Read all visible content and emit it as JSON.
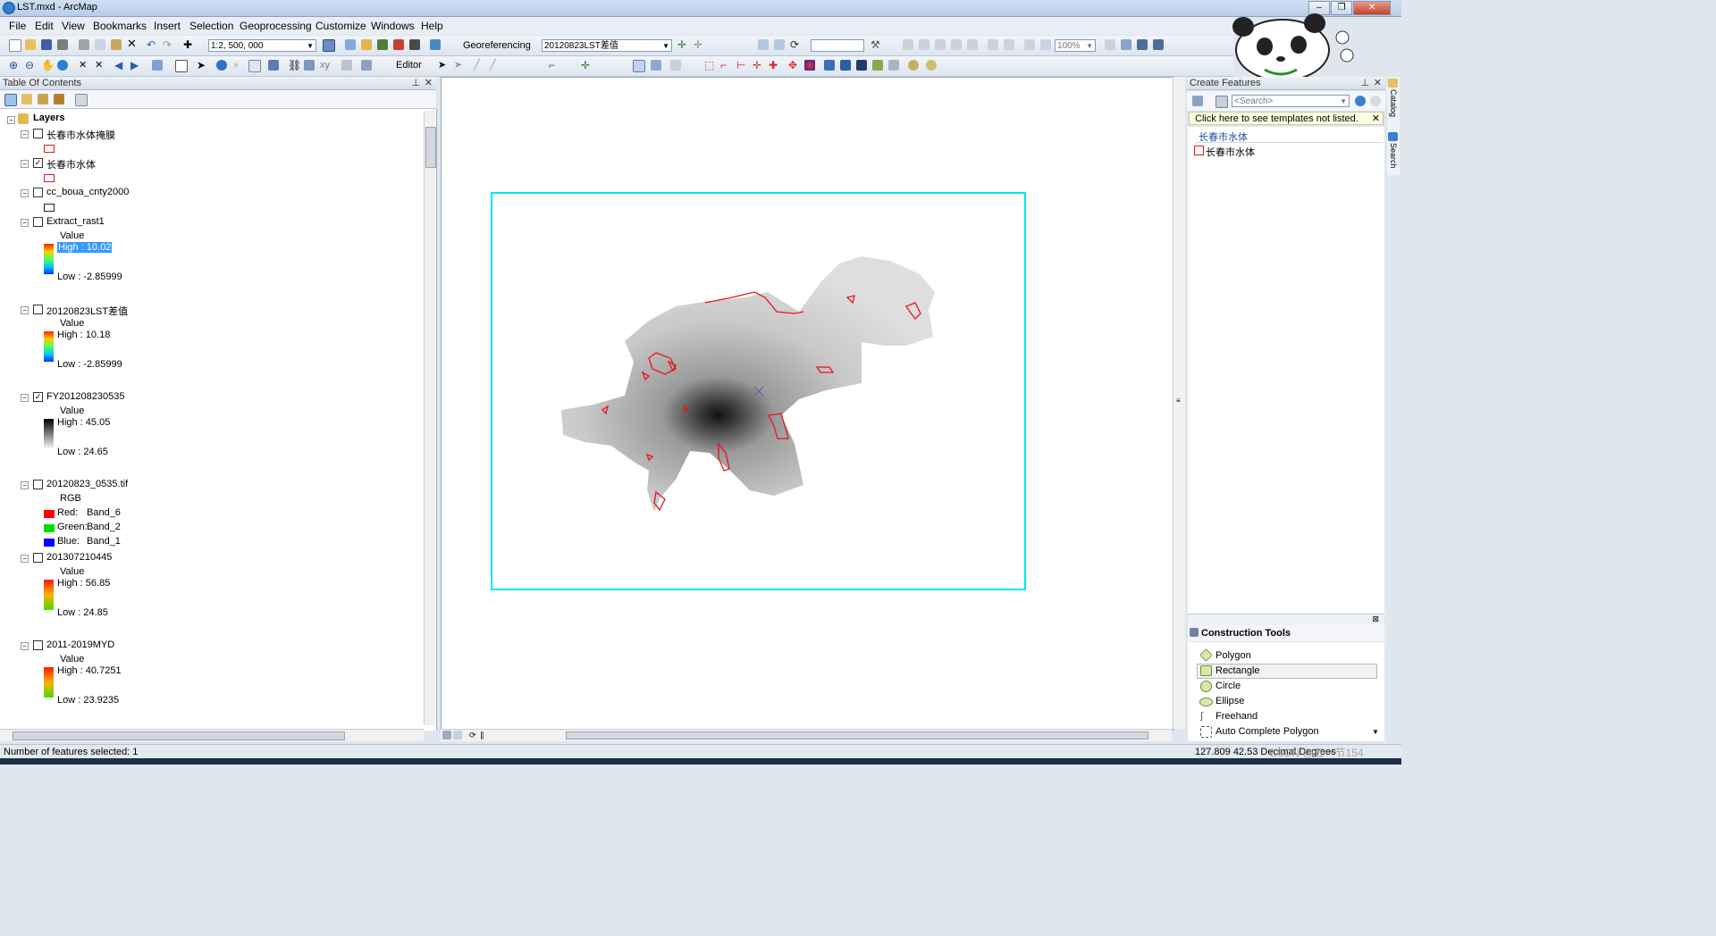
{
  "window": {
    "title": "LST.mxd - ArcMap"
  },
  "menu": [
    "File",
    "Edit",
    "View",
    "Bookmarks",
    "Insert",
    "Selection",
    "Geoprocessing",
    "Customize",
    "Windows",
    "Help"
  ],
  "toolbar": {
    "scale_value": "1:2, 500, 000",
    "georeferencing_label": "Georeferencing",
    "georef_layer": "20120823LST差值",
    "zoom_percent": "100%",
    "editor_label": "Editor"
  },
  "toc": {
    "title": "Table Of Contents",
    "root": "Layers",
    "layers": [
      {
        "name": "长春市水体掩膜",
        "checked": false
      },
      {
        "name": "长春市水体",
        "checked": true
      },
      {
        "name": "cc_boua_cnty2000",
        "checked": false
      },
      {
        "name": "Extract_rast1",
        "checked": false,
        "value_label": "Value",
        "high": "High : 10.02",
        "low": "Low : -2.85999"
      },
      {
        "name": "20120823LST差值",
        "checked": false,
        "value_label": "Value",
        "high": "High : 10.18",
        "low": "Low : -2.85999"
      },
      {
        "name": "FY201208230535",
        "checked": true,
        "value_label": "Value",
        "high": "High : 45.05",
        "low": "Low : 24.65"
      },
      {
        "name": "20120823_0535.tif",
        "checked": false,
        "rgb_label": "RGB",
        "red": "Red:",
        "red_band": "Band_6",
        "green": "Green:",
        "green_band": "Band_2",
        "blue": "Blue:",
        "blue_band": "Band_1"
      },
      {
        "name": "201307210445",
        "checked": false,
        "value_label": "Value",
        "high": "High : 56.85",
        "low": "Low : 24.85"
      },
      {
        "name": "2011-2019MYD",
        "checked": false,
        "value_label": "Value",
        "high": "High : 40.7251",
        "low": "Low : 23.9235"
      }
    ]
  },
  "create_features": {
    "title": "Create Features",
    "search_placeholder": "<Search>",
    "hint": "Click here to see templates not listed.",
    "group": "长春市水体",
    "template": "长春市水体"
  },
  "construction_tools": {
    "title": "Construction Tools",
    "items": [
      "Polygon",
      "Rectangle",
      "Circle",
      "Ellipse",
      "Freehand",
      "Auto Complete Polygon"
    ]
  },
  "side_tabs": [
    "Catalog",
    "Search"
  ],
  "status": {
    "selected": "Number of features selected: 1",
    "coords": "127.809  42.53 Decimal Degrees"
  },
  "watermark": "CSDN @五一节154",
  "colors": {
    "frame": "#00e5f0",
    "water": "#e8141c",
    "highlight": "#3399ff"
  }
}
